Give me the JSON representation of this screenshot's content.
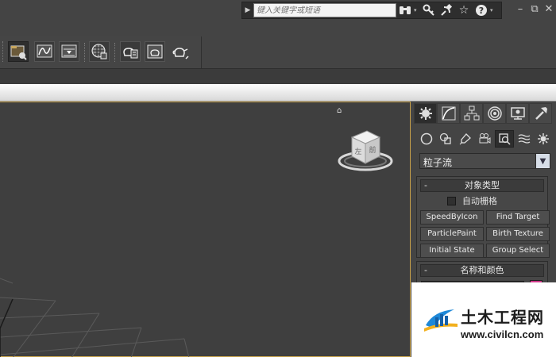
{
  "search": {
    "placeholder": "键入关键字或短语"
  },
  "infobar": {
    "icons": [
      "binoculars-icon",
      "key-icon",
      "satellite-icon",
      "star-icon",
      "help-icon"
    ]
  },
  "window": {
    "minimize": "–",
    "restore": "⧉",
    "close": "✕"
  },
  "main_toolbar": {
    "buttons": [
      "scene-explorer",
      "curve-editor",
      "dope-sheet",
      "material-editor",
      "render-setup",
      "rendered-frame-window",
      "render-production"
    ]
  },
  "command_panel": {
    "tabs": [
      "create",
      "modify",
      "hierarchy",
      "motion",
      "display",
      "utilities"
    ],
    "active_tab": "create",
    "subcategories": [
      "geometry",
      "shapes",
      "lights",
      "cameras",
      "helpers",
      "space-warps",
      "systems"
    ],
    "active_subcategory": "helpers",
    "category_dropdown": {
      "selected": "粒子流"
    },
    "object_type": {
      "title": "对象类型",
      "autogrid_label": "自动栅格",
      "buttons": [
        "SpeedByIcon",
        "Find Target",
        "ParticlePaint",
        "Birth Texture",
        "Initial State",
        "Group Select"
      ]
    },
    "name_color": {
      "title": "名称和颜色"
    },
    "colors": {
      "viewport_border": "#c8a24a",
      "active_tab_bg": "#2d2d2d"
    }
  },
  "viewcube": {
    "faces": [
      "左",
      "前"
    ]
  },
  "watermark": {
    "title": "土木工程网",
    "url": "www.civilcn.com"
  }
}
